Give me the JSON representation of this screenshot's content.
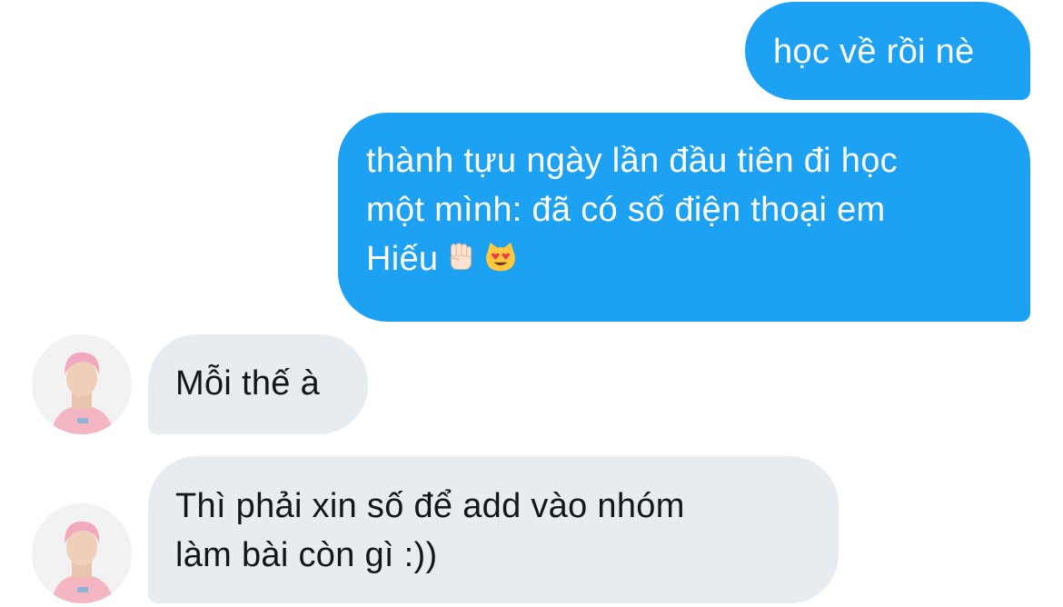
{
  "conversation": {
    "messages": [
      {
        "direction": "outgoing",
        "lines": [
          "học về rồi nè"
        ]
      },
      {
        "direction": "outgoing",
        "lines": [
          "thành tựu ngày lần đầu tiên đi học",
          "một mình: đã có số điện thoại em",
          "Hiếu"
        ],
        "emojis": [
          "raised-fist-emoji",
          "heart-eyes-cat-emoji"
        ]
      },
      {
        "direction": "incoming",
        "lines": [
          "Mỗi thế à"
        ]
      },
      {
        "direction": "incoming",
        "lines": [
          "Thì phải xin số để add vào nhóm",
          "làm bài còn gì :))"
        ]
      }
    ]
  },
  "colors": {
    "outgoing_bubble": "#1da1f2",
    "incoming_bubble": "#e6ecf0",
    "outgoing_text": "#ffffff",
    "incoming_text": "#14171a"
  }
}
